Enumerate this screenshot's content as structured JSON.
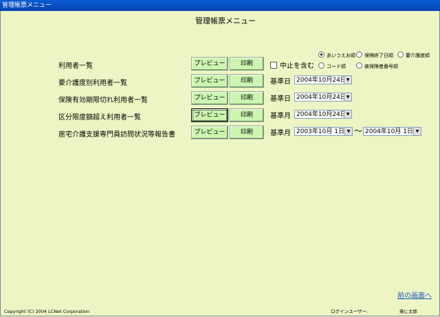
{
  "window": {
    "title": "管理帳票メニュー"
  },
  "page_title": "管理帳票メニュー",
  "rows": [
    {
      "label": "利用者一覧",
      "preview_label": "プレビュー",
      "print_label": "印刷"
    },
    {
      "label": "要介護度別利用者一覧",
      "preview_label": "プレビュー",
      "print_label": "印刷",
      "field_label": "基準日",
      "date": "2004年10月24日"
    },
    {
      "label": "保険有効期限切れ利用者一覧",
      "preview_label": "プレビュー",
      "print_label": "印刷",
      "field_label": "基準日",
      "date": "2004年10月24日"
    },
    {
      "label": "区分限度額超え利用者一覧",
      "preview_label": "プレビュー",
      "print_label": "印刷",
      "field_label": "基準月",
      "date": "2004年10月24日"
    },
    {
      "label": "居宅介護支援専門員訪問状況等報告書",
      "preview_label": "プレビュー",
      "print_label": "印刷",
      "field_label": "基準月",
      "date_from": "2003年10月  1日",
      "date_to": "2004年10月  1日",
      "range_sep": "～"
    }
  ],
  "options": {
    "include_stopped_label": "中止を含む",
    "sort": {
      "aiueo": "あいうえお順",
      "expiry": "保険終了日順",
      "care_level": "要介護度順",
      "code": "コード順",
      "insured_no": "被保険者番号順",
      "selected": "aiueo"
    }
  },
  "back_link": "前の画面へ",
  "footer": {
    "copyright": "Copyright (C) 2004 LCNet Corporation",
    "login_label": "ログインユーザー:",
    "login_user": "楽に太郎"
  }
}
